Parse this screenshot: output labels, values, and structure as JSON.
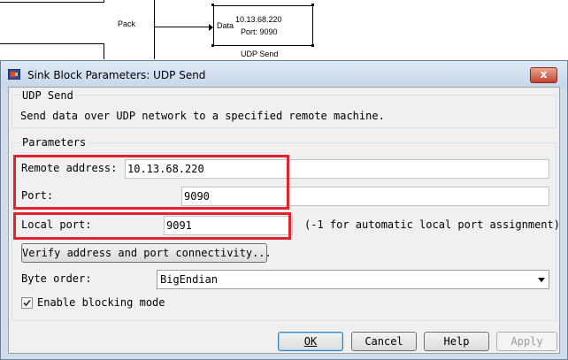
{
  "model": {
    "pack_label": "Pack",
    "udp_block": {
      "port_label": "Data",
      "address": "10.13.68.220",
      "port": "Port: 9090",
      "name": "UDP Send"
    }
  },
  "dialog": {
    "title": "Sink Block Parameters: UDP Send",
    "close_label": "x",
    "block_group_title": "UDP Send",
    "description": "Send data over UDP network to a specified remote machine.",
    "parameters_title": "Parameters",
    "remote_address_label": "Remote address:",
    "remote_address_value": "10.13.68.220",
    "port_label": "Port:",
    "port_value": "9090",
    "local_port_label": "Local port:",
    "local_port_value": "9091",
    "local_port_hint": "(-1 for automatic local port assignment)",
    "verify_button": "Verify address and port connectivity...",
    "byte_order_label": "Byte order:",
    "byte_order_value": "BigEndian",
    "blocking_label": "Enable blocking mode",
    "blocking_checked": true,
    "buttons": {
      "ok": "OK",
      "cancel": "Cancel",
      "help": "Help",
      "apply": "Apply"
    }
  },
  "colors": {
    "highlight": "#e0232c",
    "frame": "#cfdcec",
    "client": "#f0f0f0"
  }
}
